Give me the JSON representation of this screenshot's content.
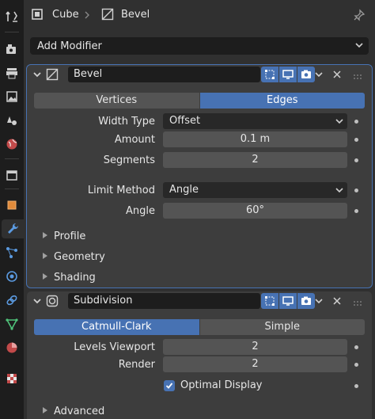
{
  "header": {
    "object_name": "Cube",
    "modifier_name": "Bevel"
  },
  "add_modifier": {
    "label": "Add Modifier"
  },
  "bevel": {
    "name": "Bevel",
    "affect_options": [
      "Vertices",
      "Edges"
    ],
    "affect_selected": "Edges",
    "width_type": {
      "label": "Width Type",
      "value": "Offset"
    },
    "amount": {
      "label": "Amount",
      "value": "0.1 m"
    },
    "segments": {
      "label": "Segments",
      "value": "2"
    },
    "limit_method": {
      "label": "Limit Method",
      "value": "Angle"
    },
    "angle": {
      "label": "Angle",
      "value": "60°"
    },
    "subpanels": [
      "Profile",
      "Geometry",
      "Shading"
    ]
  },
  "subdivision": {
    "name": "Subdivision",
    "type_options": [
      "Catmull-Clark",
      "Simple"
    ],
    "type_selected": "Catmull-Clark",
    "levels_viewport": {
      "label": "Levels Viewport",
      "value": "2"
    },
    "render": {
      "label": "Render",
      "value": "2"
    },
    "optimal_display": {
      "label": "Optimal Display",
      "checked": true
    },
    "subpanels": [
      "Advanced"
    ]
  },
  "colors": {
    "accent": "#4772b3",
    "panel": "#3d3d3d",
    "background": "#303030",
    "tabstrip": "#1d1d1d"
  }
}
